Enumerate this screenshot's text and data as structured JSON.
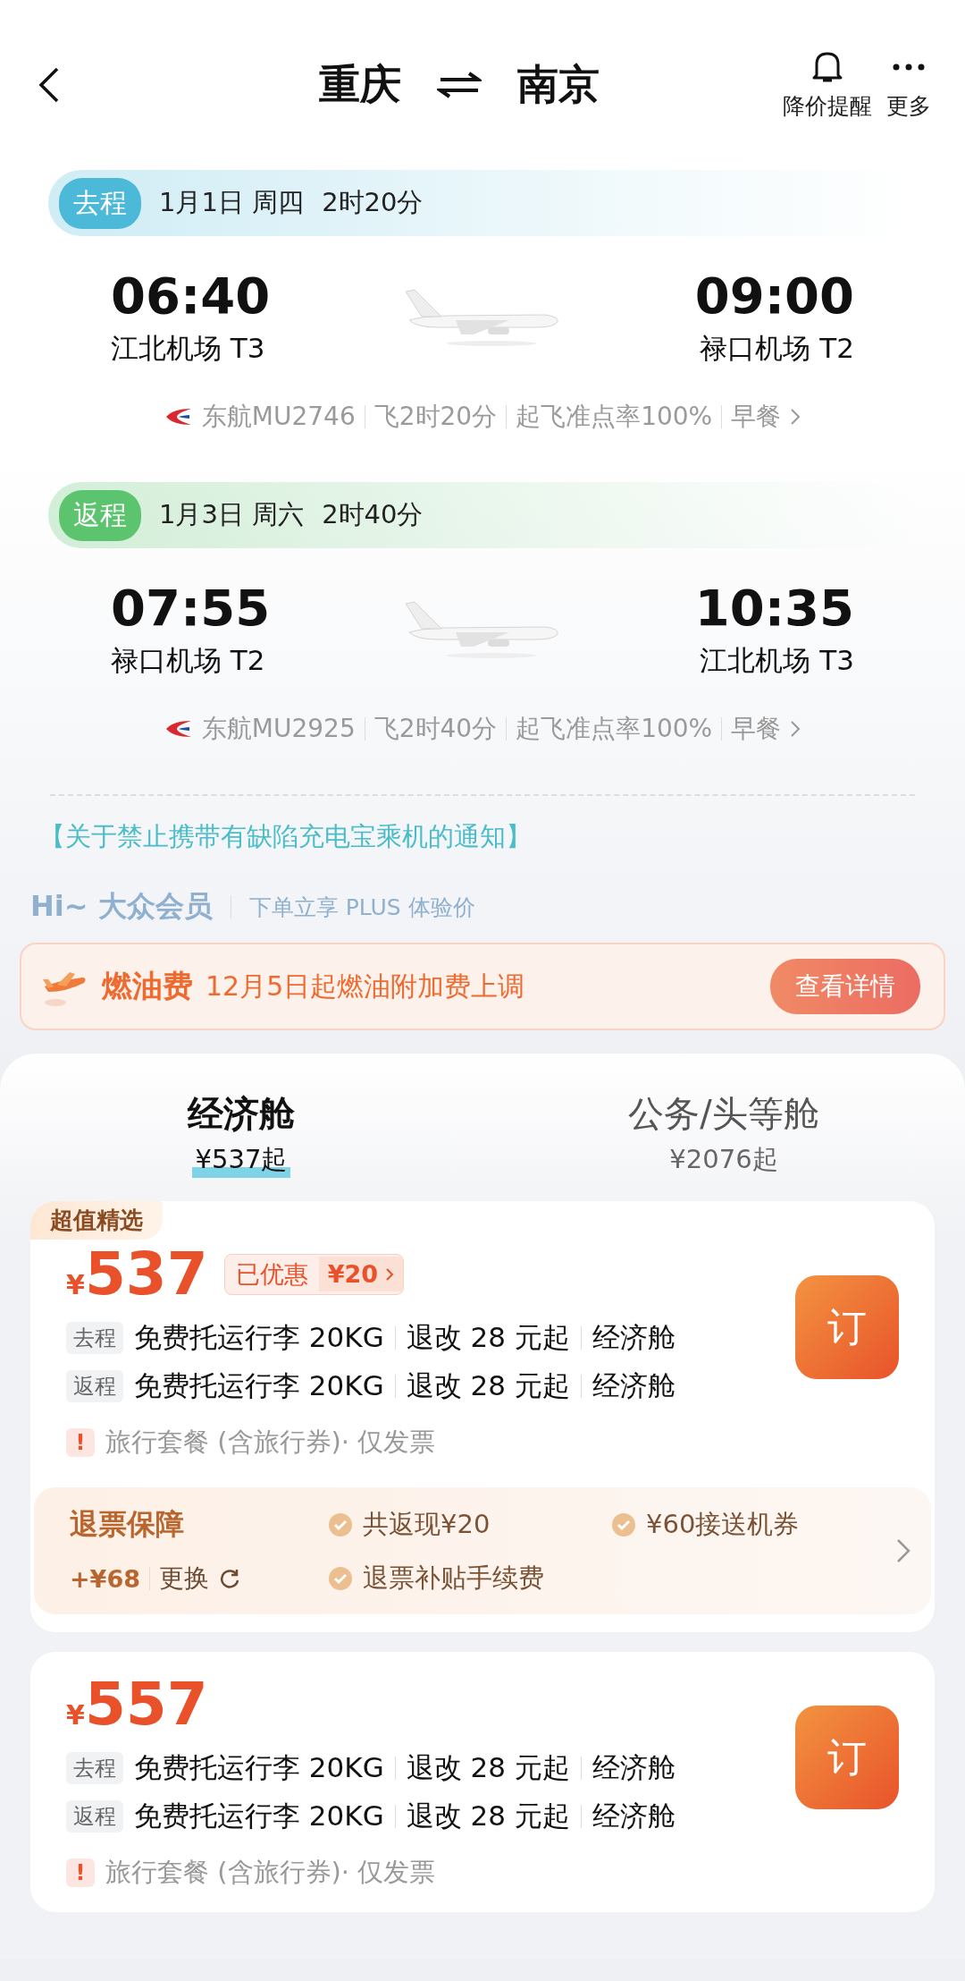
{
  "header": {
    "from": "重庆",
    "to": "南京",
    "actions": [
      {
        "kind": "bell",
        "label": "降价提醒"
      },
      {
        "kind": "more",
        "label": "更多"
      }
    ]
  },
  "legs": [
    {
      "tag": "去程",
      "color": "#4db9d9",
      "date": "1月1日 周四",
      "duration": "2时20分",
      "dep_time": "06:40",
      "dep_airport": "江北机场 T3",
      "arr_time": "09:00",
      "arr_airport": "禄口机场 T2",
      "info": [
        "东航MU2746",
        "飞2时20分",
        "起飞准点率100%",
        "早餐"
      ]
    },
    {
      "tag": "返程",
      "color": "#5cc46e",
      "date": "1月3日 周六",
      "duration": "2时40分",
      "dep_time": "07:55",
      "dep_airport": "禄口机场 T2",
      "arr_time": "10:35",
      "arr_airport": "江北机场 T3",
      "info": [
        "东航MU2925",
        "飞2时40分",
        "起飞准点率100%",
        "早餐"
      ]
    }
  ],
  "notice": "【关于禁止携带有缺陷充电宝乘机的通知】",
  "member": {
    "title": "Hi~ 大众会员",
    "text": "下单立享 PLUS 体验价"
  },
  "fuel": {
    "title": "燃油费",
    "text": "12月5日起燃油附加费上调",
    "button": "查看详情"
  },
  "cabin_tabs": [
    {
      "label": "经济舱",
      "price": "¥537起",
      "selected": true
    },
    {
      "label": "公务/头等舱",
      "price": "¥2076起",
      "selected": false
    }
  ],
  "offers": [
    {
      "badge": "超值精选",
      "currency": "¥",
      "price": "537",
      "discount": {
        "label": "已优惠",
        "amount": "¥20"
      },
      "book": "订",
      "segments": [
        {
          "tag": "去程",
          "items": [
            "免费托运行李 20KG",
            "退改 28 元起",
            "经济舱"
          ]
        },
        {
          "tag": "返程",
          "items": [
            "免费托运行李 20KG",
            "退改 28 元起",
            "经济舱"
          ]
        }
      ],
      "note": {
        "icon": "!",
        "text": "旅行套餐 (含旅行券)· 仅发票"
      },
      "protection": {
        "title": "退票保障",
        "price": "+¥68",
        "action": "更换",
        "benefits": [
          "共返现¥20",
          "¥60接送机券",
          "退票补贴手续费"
        ]
      }
    },
    {
      "currency": "¥",
      "price": "557",
      "book": "订",
      "segments": [
        {
          "tag": "去程",
          "items": [
            "免费托运行李 20KG",
            "退改 28 元起",
            "经济舱"
          ]
        },
        {
          "tag": "返程",
          "items": [
            "免费托运行李 20KG",
            "退改 28 元起",
            "经济舱"
          ]
        }
      ],
      "note": {
        "icon": "!",
        "text": "旅行套餐 (含旅行券)· 仅发票"
      }
    }
  ]
}
